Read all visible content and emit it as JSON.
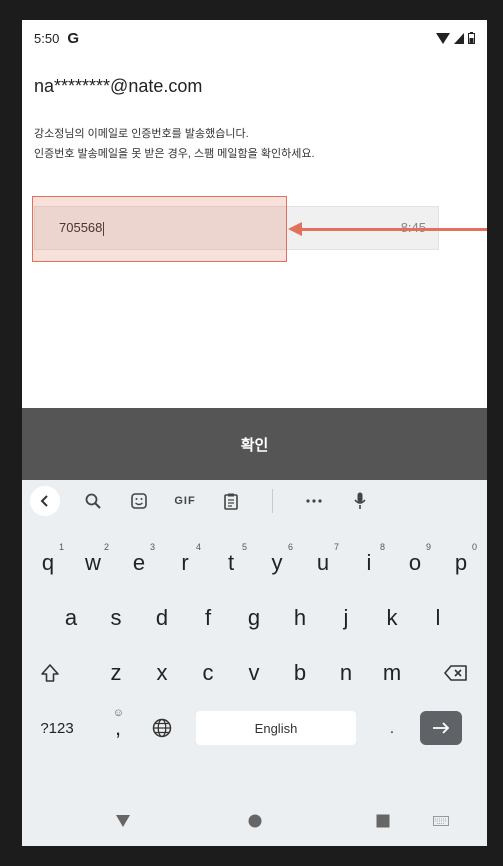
{
  "status_bar": {
    "time": "5:50",
    "app_icon": "G",
    "icons": [
      "wifi-icon",
      "signal-icon",
      "battery-icon"
    ]
  },
  "account": {
    "email": "na********@nate.com"
  },
  "notice": {
    "line1": "강소정님의 이메일로 인증번호를 발송했습니다.",
    "line2": "인증번호 발송메일을 못 받은 경우, 스팸 메일함을 확인하세요."
  },
  "verification": {
    "code": "705568",
    "timer": "8:45"
  },
  "confirm_button": {
    "label": "확인"
  },
  "keyboard": {
    "toolbar": [
      "chevron-left-icon",
      "search-icon",
      "sticker-icon",
      "GIF",
      "clipboard-icon",
      "more-icon",
      "mic-icon"
    ],
    "row1": [
      {
        "key": "q",
        "hint": "1"
      },
      {
        "key": "w",
        "hint": "2"
      },
      {
        "key": "e",
        "hint": "3"
      },
      {
        "key": "r",
        "hint": "4"
      },
      {
        "key": "t",
        "hint": "5"
      },
      {
        "key": "y",
        "hint": "6"
      },
      {
        "key": "u",
        "hint": "7"
      },
      {
        "key": "i",
        "hint": "8"
      },
      {
        "key": "o",
        "hint": "9"
      },
      {
        "key": "p",
        "hint": "0"
      }
    ],
    "row2": [
      "a",
      "s",
      "d",
      "f",
      "g",
      "h",
      "j",
      "k",
      "l"
    ],
    "row3": [
      "z",
      "x",
      "c",
      "v",
      "b",
      "n",
      "m"
    ],
    "symbols_label": "?123",
    "comma_label": ",",
    "emoji_hint": "☺",
    "space_label": "English",
    "period_label": ".",
    "enter_icon": "arrow-right-icon"
  },
  "nav_bar": [
    "back-icon",
    "home-icon",
    "recents-icon",
    "keyboard-switch-icon"
  ],
  "annotation": {
    "highlight_color": "#e1715a"
  },
  "colors": {
    "confirm_bg": "#555555",
    "keyboard_bg": "#eceff1"
  }
}
